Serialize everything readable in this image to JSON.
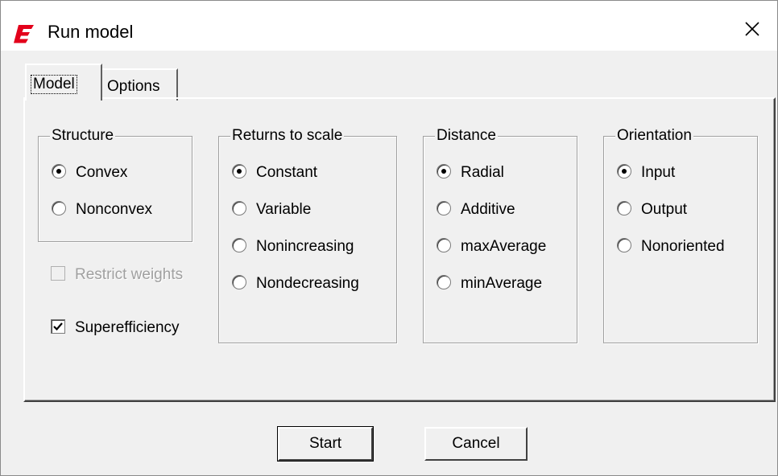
{
  "window": {
    "title": "Run model",
    "app_icon": "red-E-logo-icon",
    "close_icon": "close-x-icon",
    "brand_color": "#e3001b"
  },
  "tabs": [
    {
      "label": "Model",
      "active": true
    },
    {
      "label": "Options",
      "active": false
    }
  ],
  "structure": {
    "legend": "Structure",
    "options": [
      {
        "label": "Convex",
        "selected": true
      },
      {
        "label": "Nonconvex",
        "selected": false
      }
    ]
  },
  "restrict_weights": {
    "label": "Restrict weights",
    "checked": false,
    "enabled": false
  },
  "superefficiency": {
    "label": "Superefficiency",
    "checked": true,
    "enabled": true
  },
  "returns_to_scale": {
    "legend": "Returns to scale",
    "options": [
      {
        "label": "Constant",
        "selected": true
      },
      {
        "label": "Variable",
        "selected": false
      },
      {
        "label": "Nonincreasing",
        "selected": false
      },
      {
        "label": "Nondecreasing",
        "selected": false
      }
    ]
  },
  "distance": {
    "legend": "Distance",
    "options": [
      {
        "label": "Radial",
        "selected": true
      },
      {
        "label": "Additive",
        "selected": false
      },
      {
        "label": "maxAverage",
        "selected": false
      },
      {
        "label": "minAverage",
        "selected": false
      }
    ]
  },
  "orientation": {
    "legend": "Orientation",
    "options": [
      {
        "label": "Input",
        "selected": true
      },
      {
        "label": "Output",
        "selected": false
      },
      {
        "label": "Nonoriented",
        "selected": false
      }
    ]
  },
  "buttons": {
    "start": "Start",
    "cancel": "Cancel"
  }
}
